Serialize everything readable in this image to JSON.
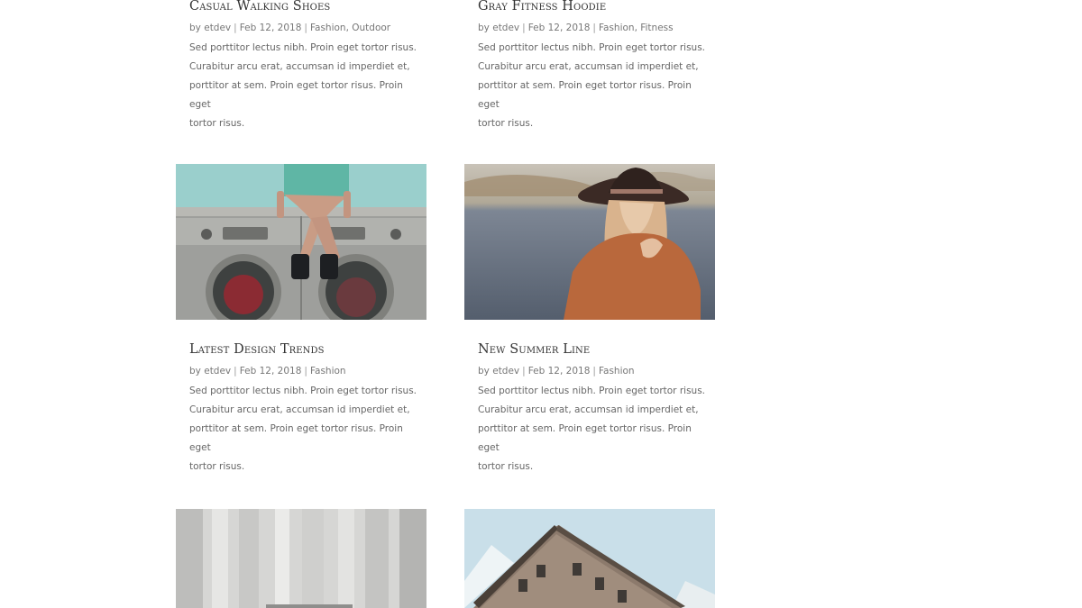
{
  "posts": [
    {
      "title": "Casual Walking Shoes",
      "meta": {
        "by": "by",
        "author": "etdev",
        "date": "Feb 12, 2018",
        "categories": "Fashion, Outdoor"
      },
      "excerpt_lines": [
        "Sed porttitor lectus nibh. Proin eget tortor risus.",
        "Curabitur arcu erat, accumsan id imperdiet et,",
        "porttitor at sem. Proin eget tortor risus. Proin eget",
        "tortor risus."
      ]
    },
    {
      "title": "Gray Fitness Hoodie",
      "meta": {
        "by": "by",
        "author": "etdev",
        "date": "Feb 12, 2018",
        "categories": "Fashion, Fitness"
      },
      "excerpt_lines": [
        "Sed porttitor lectus nibh. Proin eget tortor risus.",
        "Curabitur arcu erat, accumsan id imperdiet et,",
        "porttitor at sem. Proin eget tortor risus. Proin eget",
        "tortor risus."
      ]
    },
    {
      "title": "Latest Design Trends",
      "image_alt": "laundromat-photo",
      "meta": {
        "by": "by",
        "author": "etdev",
        "date": "Feb 12, 2018",
        "categories": "Fashion"
      },
      "excerpt_lines": [
        "Sed porttitor lectus nibh. Proin eget tortor risus.",
        "Curabitur arcu erat, accumsan id imperdiet et,",
        "porttitor at sem. Proin eget tortor risus. Proin eget",
        "tortor risus."
      ]
    },
    {
      "title": "New Summer Line",
      "image_alt": "woman-in-hat-photo",
      "meta": {
        "by": "by",
        "author": "etdev",
        "date": "Feb 12, 2018",
        "categories": "Fashion"
      },
      "excerpt_lines": [
        "Sed porttitor lectus nibh. Proin eget tortor risus.",
        "Curabitur arcu erat, accumsan id imperdiet et,",
        "porttitor at sem. Proin eget tortor risus. Proin eget",
        "tortor risus."
      ]
    }
  ],
  "colors": {
    "title": "#333333",
    "meta": "#777777",
    "text": "#666666",
    "background": "#ffffff"
  }
}
